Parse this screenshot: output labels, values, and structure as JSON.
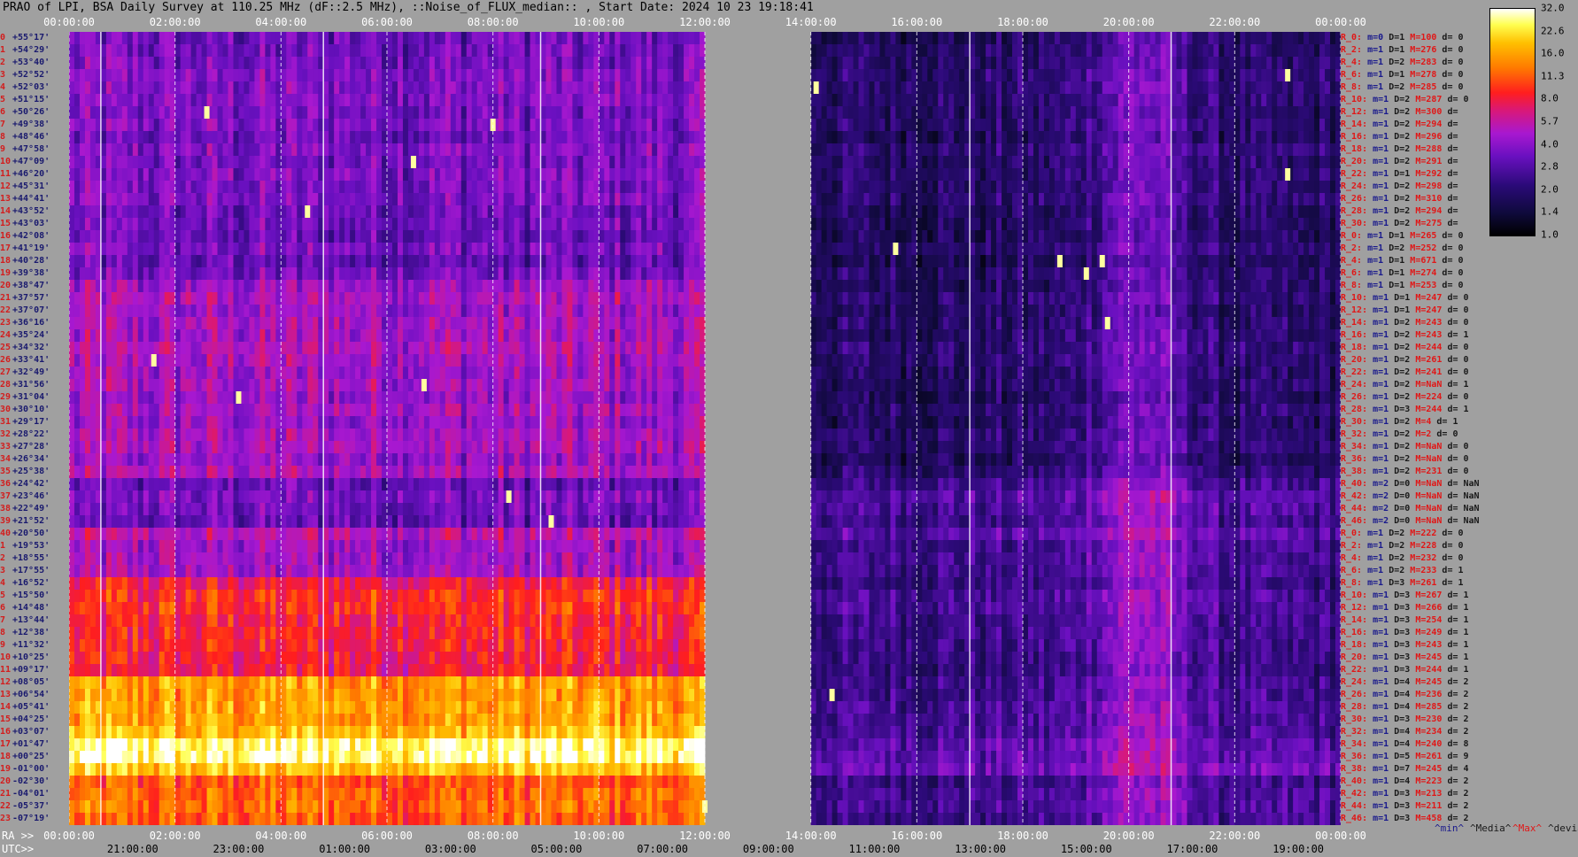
{
  "title": "PRAO of LPI, BSA Daily Survey at 110.25 MHz (dF::2.5 MHz), ::Noise_of_FLUX_median:: , Start Date: 2024 10 23 19:18:41",
  "chart_data": {
    "type": "heatmap",
    "top_ticks": [
      "00:00:00",
      "02:00:00",
      "04:00:00",
      "06:00:00",
      "08:00:00",
      "10:00:00",
      "12:00:00",
      "14:00:00",
      "16:00:00",
      "18:00:00",
      "20:00:00",
      "22:00:00",
      "00:00:00"
    ],
    "ra_prefix": "RA >>",
    "ra_ticks": [
      "00:00:00",
      "02:00:00",
      "04:00:00",
      "06:00:00",
      "08:00:00",
      "10:00:00",
      "12:00:00",
      "14:00:00",
      "16:00:00",
      "18:00:00",
      "20:00:00",
      "22:00:00",
      "00:00:00"
    ],
    "utc_prefix": "UTC>>",
    "utc_ticks": [
      "21:00:00",
      "23:00:00",
      "01:00:00",
      "03:00:00",
      "05:00:00",
      "07:00:00",
      "09:00:00",
      "11:00:00",
      "13:00:00",
      "15:00:00",
      "17:00:00",
      "19:00:00"
    ],
    "x_range_hours": [
      0,
      24
    ],
    "data_gap_hours": [
      12,
      14
    ],
    "masked_rows": [
      41,
      42,
      43,
      44
    ],
    "masked_from_hours": 8.9,
    "colorbar": {
      "ticks": [
        "32.0",
        "22.6",
        "16.0",
        "11.3",
        "8.0",
        "5.7",
        "4.0",
        "2.8",
        "2.0",
        "1.4",
        "1.0"
      ],
      "scale": "log",
      "range": [
        1.0,
        32.0
      ]
    },
    "rows": [
      {
        "idx": "0",
        "dec": "+55°17'",
        "info": [
          "R_0:",
          "m=0",
          "D=1",
          "M=100",
          "d= 0"
        ]
      },
      {
        "idx": "1",
        "dec": "+54°29'",
        "info": [
          "R_2:",
          "m=1",
          "D=1",
          "M=276",
          "d= 0"
        ]
      },
      {
        "idx": "2",
        "dec": "+53°40'",
        "info": [
          "R_4:",
          "m=1",
          "D=2",
          "M=283",
          "d= 0"
        ]
      },
      {
        "idx": "3",
        "dec": "+52°52'",
        "info": [
          "R_6:",
          "m=1",
          "D=1",
          "M=278",
          "d= 0"
        ]
      },
      {
        "idx": "4",
        "dec": "+52°03'",
        "info": [
          "R_8:",
          "m=1",
          "D=2",
          "M=285",
          "d= 0"
        ]
      },
      {
        "idx": "5",
        "dec": "+51°15'",
        "info": [
          "R_10:",
          "m=1",
          "D=2",
          "M=287",
          "d= 0"
        ]
      },
      {
        "idx": "6",
        "dec": "+50°26'",
        "info": [
          "R_12:",
          "m=1",
          "D=2",
          "M=300",
          "d="
        ]
      },
      {
        "idx": "7",
        "dec": "+49°38'",
        "info": [
          "R_14:",
          "m=1",
          "D=2",
          "M=294",
          "d="
        ]
      },
      {
        "idx": "8",
        "dec": "+48°46'",
        "info": [
          "R_16:",
          "m=1",
          "D=2",
          "M=296",
          "d="
        ]
      },
      {
        "idx": "9",
        "dec": "+47°58'",
        "info": [
          "R_18:",
          "m=1",
          "D=2",
          "M=288",
          "d="
        ]
      },
      {
        "idx": "10",
        "dec": "+47°09'",
        "info": [
          "R_20:",
          "m=1",
          "D=2",
          "M=291",
          "d="
        ]
      },
      {
        "idx": "11",
        "dec": "+46°20'",
        "info": [
          "R_22:",
          "m=1",
          "D=1",
          "M=292",
          "d="
        ]
      },
      {
        "idx": "12",
        "dec": "+45°31'",
        "info": [
          "R_24:",
          "m=1",
          "D=2",
          "M=298",
          "d="
        ]
      },
      {
        "idx": "13",
        "dec": "+44°41'",
        "info": [
          "R_26:",
          "m=1",
          "D=2",
          "M=310",
          "d="
        ]
      },
      {
        "idx": "14",
        "dec": "+43°52'",
        "info": [
          "R_28:",
          "m=1",
          "D=2",
          "M=294",
          "d="
        ]
      },
      {
        "idx": "15",
        "dec": "+43°03'",
        "info": [
          "R_30:",
          "m=1",
          "D=2",
          "M=275",
          "d="
        ]
      },
      {
        "idx": "16",
        "dec": "+42°08'",
        "info": [
          "R_0:",
          "m=1",
          "D=1",
          "M=265",
          "d= 0"
        ]
      },
      {
        "idx": "17",
        "dec": "+41°19'",
        "info": [
          "R_2:",
          "m=1",
          "D=2",
          "M=252",
          "d= 0"
        ]
      },
      {
        "idx": "18",
        "dec": "+40°28'",
        "info": [
          "R_4:",
          "m=1",
          "D=1",
          "M=671",
          "d= 0"
        ]
      },
      {
        "idx": "19",
        "dec": "+39°38'",
        "info": [
          "R_6:",
          "m=1",
          "D=1",
          "M=274",
          "d= 0"
        ]
      },
      {
        "idx": "20",
        "dec": "+38°47'",
        "info": [
          "R_8:",
          "m=1",
          "D=1",
          "M=253",
          "d= 0"
        ]
      },
      {
        "idx": "21",
        "dec": "+37°57'",
        "info": [
          "R_10:",
          "m=1",
          "D=1",
          "M=247",
          "d= 0"
        ]
      },
      {
        "idx": "22",
        "dec": "+37°07'",
        "info": [
          "R_12:",
          "m=1",
          "D=1",
          "M=247",
          "d= 0"
        ]
      },
      {
        "idx": "23",
        "dec": "+36°16'",
        "info": [
          "R_14:",
          "m=1",
          "D=2",
          "M=243",
          "d= 0"
        ]
      },
      {
        "idx": "24",
        "dec": "+35°24'",
        "info": [
          "R_16:",
          "m=1",
          "D=2",
          "M=243",
          "d= 1"
        ]
      },
      {
        "idx": "25",
        "dec": "+34°32'",
        "info": [
          "R_18:",
          "m=1",
          "D=2",
          "M=244",
          "d= 0"
        ]
      },
      {
        "idx": "26",
        "dec": "+33°41'",
        "info": [
          "R_20:",
          "m=1",
          "D=2",
          "M=261",
          "d= 0"
        ]
      },
      {
        "idx": "27",
        "dec": "+32°49'",
        "info": [
          "R_22:",
          "m=1",
          "D=2",
          "M=241",
          "d= 0"
        ]
      },
      {
        "idx": "28",
        "dec": "+31°56'",
        "info": [
          "R_24:",
          "m=1",
          "D=2",
          "M=NaN",
          "d= 1"
        ]
      },
      {
        "idx": "29",
        "dec": "+31°04'",
        "info": [
          "R_26:",
          "m=1",
          "D=2",
          "M=224",
          "d= 0"
        ]
      },
      {
        "idx": "30",
        "dec": "+30°10'",
        "info": [
          "R_28:",
          "m=1",
          "D=3",
          "M=244",
          "d= 1"
        ]
      },
      {
        "idx": "31",
        "dec": "+29°17'",
        "info": [
          "R_30:",
          "m=1",
          "D=2",
          "M=4",
          "d= 1"
        ]
      },
      {
        "idx": "32",
        "dec": "+28°22'",
        "info": [
          "R_32:",
          "m=1",
          "D=2",
          "M=2",
          "d= 0"
        ]
      },
      {
        "idx": "33",
        "dec": "+27°28'",
        "info": [
          "R_34:",
          "m=1",
          "D=2",
          "M=NaN",
          "d= 0"
        ]
      },
      {
        "idx": "34",
        "dec": "+26°34'",
        "info": [
          "R_36:",
          "m=1",
          "D=2",
          "M=NaN",
          "d= 0"
        ]
      },
      {
        "idx": "35",
        "dec": "+25°38'",
        "info": [
          "R_38:",
          "m=1",
          "D=2",
          "M=231",
          "d= 0"
        ]
      },
      {
        "idx": "36",
        "dec": "+24°42'",
        "info": [
          "R_40:",
          "m=2",
          "D=0",
          "M=NaN",
          "d= NaN"
        ]
      },
      {
        "idx": "37",
        "dec": "+23°46'",
        "info": [
          "R_42:",
          "m=2",
          "D=0",
          "M=NaN",
          "d= NaN"
        ]
      },
      {
        "idx": "38",
        "dec": "+22°49'",
        "info": [
          "R_44:",
          "m=2",
          "D=0",
          "M=NaN",
          "d= NaN"
        ]
      },
      {
        "idx": "39",
        "dec": "+21°52'",
        "info": [
          "R_46:",
          "m=2",
          "D=0",
          "M=NaN",
          "d= NaN"
        ]
      },
      {
        "idx": "40",
        "dec": "+20°50'",
        "info": [
          "R_0:",
          "m=1",
          "D=2",
          "M=222",
          "d= 0"
        ]
      },
      {
        "idx": "1",
        "dec": "+19°53'",
        "info": [
          "R_2:",
          "m=1",
          "D=2",
          "M=228",
          "d= 0"
        ]
      },
      {
        "idx": "2",
        "dec": "+18°55'",
        "info": [
          "R_4:",
          "m=1",
          "D=2",
          "M=232",
          "d= 0"
        ]
      },
      {
        "idx": "3",
        "dec": "+17°55'",
        "info": [
          "R_6:",
          "m=1",
          "D=2",
          "M=233",
          "d= 1"
        ]
      },
      {
        "idx": "4",
        "dec": "+16°52'",
        "info": [
          "R_8:",
          "m=1",
          "D=3",
          "M=261",
          "d= 1"
        ]
      },
      {
        "idx": "5",
        "dec": "+15°50'",
        "info": [
          "R_10:",
          "m=1",
          "D=3",
          "M=267",
          "d= 1"
        ]
      },
      {
        "idx": "6",
        "dec": "+14°48'",
        "info": [
          "R_12:",
          "m=1",
          "D=3",
          "M=266",
          "d= 1"
        ]
      },
      {
        "idx": "7",
        "dec": "+13°44'",
        "info": [
          "R_14:",
          "m=1",
          "D=3",
          "M=254",
          "d= 1"
        ]
      },
      {
        "idx": "8",
        "dec": "+12°38'",
        "info": [
          "R_16:",
          "m=1",
          "D=3",
          "M=249",
          "d= 1"
        ]
      },
      {
        "idx": "9",
        "dec": "+11°32'",
        "info": [
          "R_18:",
          "m=1",
          "D=3",
          "M=243",
          "d= 1"
        ]
      },
      {
        "idx": "10",
        "dec": "+10°25'",
        "info": [
          "R_20:",
          "m=1",
          "D=3",
          "M=245",
          "d= 1"
        ]
      },
      {
        "idx": "11",
        "dec": "+09°17'",
        "info": [
          "R_22:",
          "m=1",
          "D=3",
          "M=244",
          "d= 1"
        ]
      },
      {
        "idx": "12",
        "dec": "+08°05'",
        "info": [
          "R_24:",
          "m=1",
          "D=4",
          "M=245",
          "d= 2"
        ]
      },
      {
        "idx": "13",
        "dec": "+06°54'",
        "info": [
          "R_26:",
          "m=1",
          "D=4",
          "M=236",
          "d= 2"
        ]
      },
      {
        "idx": "14",
        "dec": "+05°41'",
        "info": [
          "R_28:",
          "m=1",
          "D=4",
          "M=285",
          "d= 2"
        ]
      },
      {
        "idx": "15",
        "dec": "+04°25'",
        "info": [
          "R_30:",
          "m=1",
          "D=3",
          "M=230",
          "d= 2"
        ]
      },
      {
        "idx": "16",
        "dec": "+03°07'",
        "info": [
          "R_32:",
          "m=1",
          "D=4",
          "M=234",
          "d= 2"
        ]
      },
      {
        "idx": "17",
        "dec": "+01°47'",
        "info": [
          "R_34:",
          "m=1",
          "D=4",
          "M=240",
          "d= 8"
        ]
      },
      {
        "idx": "18",
        "dec": "+00°25'",
        "info": [
          "R_36:",
          "m=1",
          "D=5",
          "M=261",
          "d= 9"
        ]
      },
      {
        "idx": "19",
        "dec": "-01°00'",
        "info": [
          "R_38:",
          "m=1",
          "D=7",
          "M=245",
          "d= 4"
        ]
      },
      {
        "idx": "20",
        "dec": "-02°30'",
        "info": [
          "R_40:",
          "m=1",
          "D=4",
          "M=223",
          "d= 2"
        ]
      },
      {
        "idx": "21",
        "dec": "-04°01'",
        "info": [
          "R_42:",
          "m=1",
          "D=3",
          "M=213",
          "d= 2"
        ]
      },
      {
        "idx": "22",
        "dec": "-05°37'",
        "info": [
          "R_44:",
          "m=1",
          "D=3",
          "M=211",
          "d= 2"
        ]
      },
      {
        "idx": "23",
        "dec": "-07°19'",
        "info": [
          "R_46:",
          "m=1",
          "D=3",
          "M=458",
          "d= 2"
        ]
      }
    ],
    "legend": [
      "^min^",
      "^Media^",
      "^Max^",
      "^devia^"
    ]
  },
  "colors": {
    "background": "#a0a0a0",
    "legend_min": "#1a1a8c",
    "legend_media": "#1a1a1a",
    "legend_max": "#e01818",
    "legend_devia": "#1a1a1a"
  }
}
